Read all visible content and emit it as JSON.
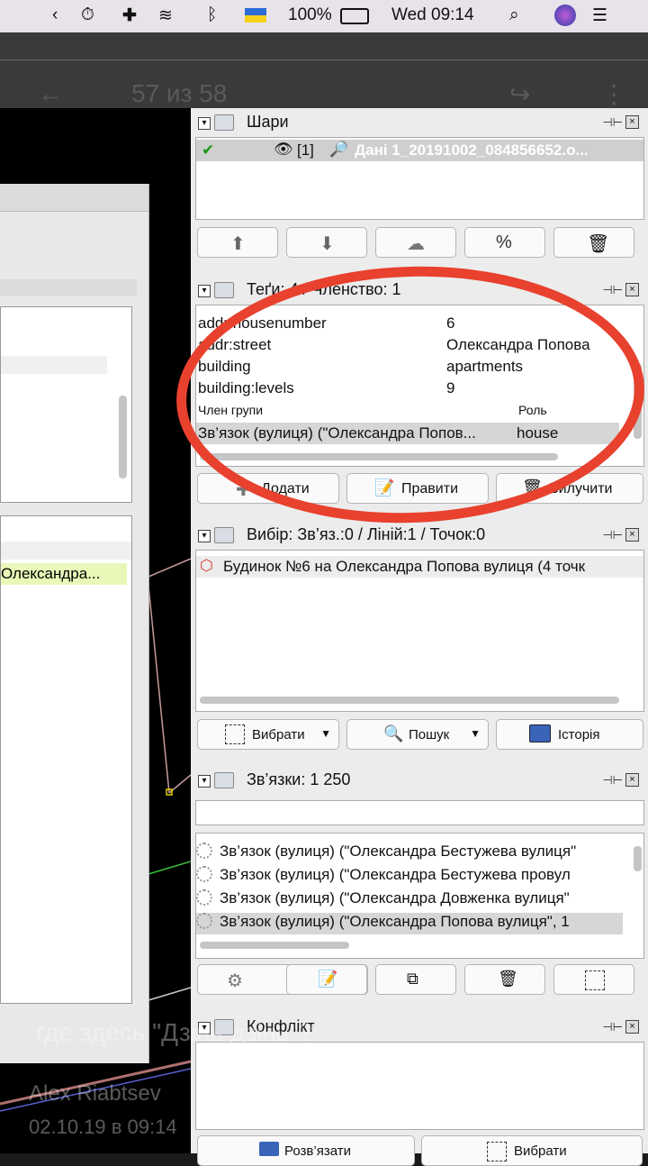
{
  "menubar": {
    "battery": "100%",
    "clock": "Wed 09:14"
  },
  "viewer": {
    "counter": "57 из 58"
  },
  "map": {
    "highlighted_cell": "Олександра..."
  },
  "layers": {
    "title": "Шари",
    "item": "[1]",
    "item_name": "Дані 1_20191002_084856652.o..."
  },
  "tags": {
    "title": "Теґи: 4 / Членство: 1",
    "rows": [
      {
        "key": "addr:housenumber",
        "value": "6"
      },
      {
        "key": "addr:street",
        "value": "Олександра Попова"
      },
      {
        "key": "building",
        "value": "apartments"
      },
      {
        "key": "building:levels",
        "value": "9"
      }
    ],
    "membership_header_member": "Член групи",
    "membership_header_role": "Роль",
    "membership_member": "Зв’язок (вулиця) (\"Олександра Попов...",
    "membership_role": "house",
    "add_label": "Додати",
    "edit_label": "Правити",
    "delete_label": "Вилучити"
  },
  "selection": {
    "title": "Вибір: Зв’яз.:0 / Ліній:1 / Точок:0",
    "item": "Будинок №6 на Олександра Попова вулиця (4 точк",
    "select_label": "Вибрати",
    "search_label": "Пошук",
    "history_label": "Історія"
  },
  "relations": {
    "title": "Зв’язки: 1 250",
    "items": [
      "Зв’язок (вулиця) (\"Олександра Бестужева вулиця\"",
      "Зв’язок (вулиця) (\"Олександра Бестужева провул",
      "Зв’язок (вулиця) (\"Олександра Довженка вулиця\"",
      "Зв’язок (вулиця) (\"Олександра Попова вулиця\", 1"
    ]
  },
  "conflict": {
    "title": "Конфлікт",
    "resolve_label": "Розв’язати",
    "select_label": "Вибрати"
  },
  "comment": {
    "text": "где здесь \"Дзінь дзінь\"?",
    "author": "Alex Riabtsev",
    "date": "02.10.19 в 09:14"
  },
  "colors": {
    "annotation": "#e8412e",
    "menubar": "#e8e3ea",
    "panel": "#ececec"
  }
}
